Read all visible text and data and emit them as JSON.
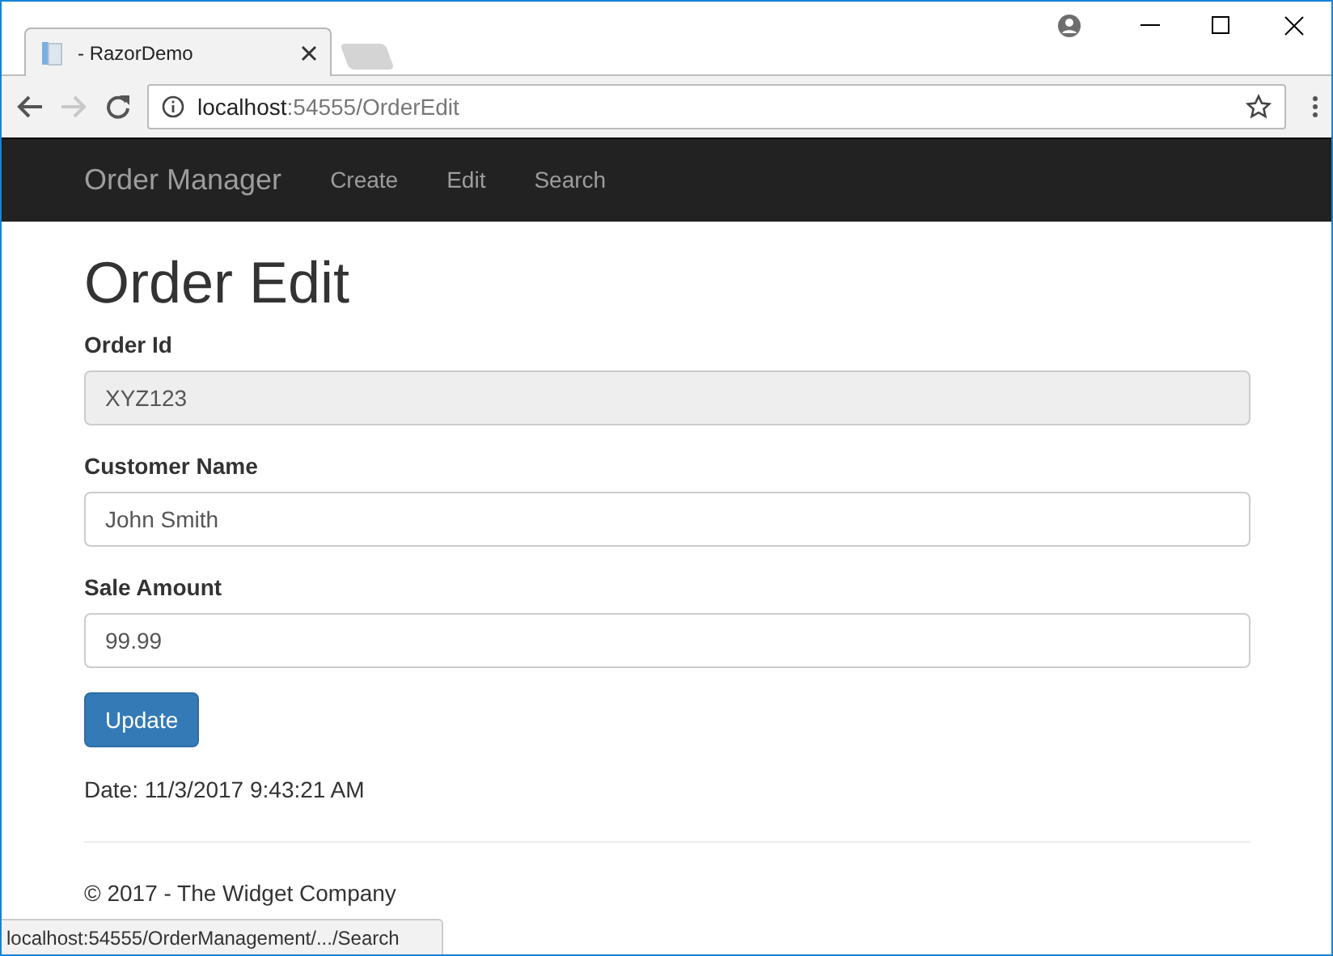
{
  "browser": {
    "tab_title": "- RazorDemo",
    "url_host": "localhost",
    "url_path": ":54555/OrderEdit",
    "status_url": "localhost:54555/OrderManagement/.../Search"
  },
  "navbar": {
    "brand": "Order Manager",
    "links": [
      {
        "label": "Create"
      },
      {
        "label": "Edit"
      },
      {
        "label": "Search"
      }
    ]
  },
  "heading": "Order Edit",
  "fields": [
    {
      "label": "Order Id",
      "value": "XYZ123",
      "disabled": true
    },
    {
      "label": "Customer Name",
      "value": "John Smith",
      "disabled": false
    },
    {
      "label": "Sale Amount",
      "value": "99.99",
      "disabled": false
    }
  ],
  "button": "Update",
  "date": "Date: 11/3/2017 9:43:21 AM",
  "footer": "© 2017 - The Widget Company"
}
